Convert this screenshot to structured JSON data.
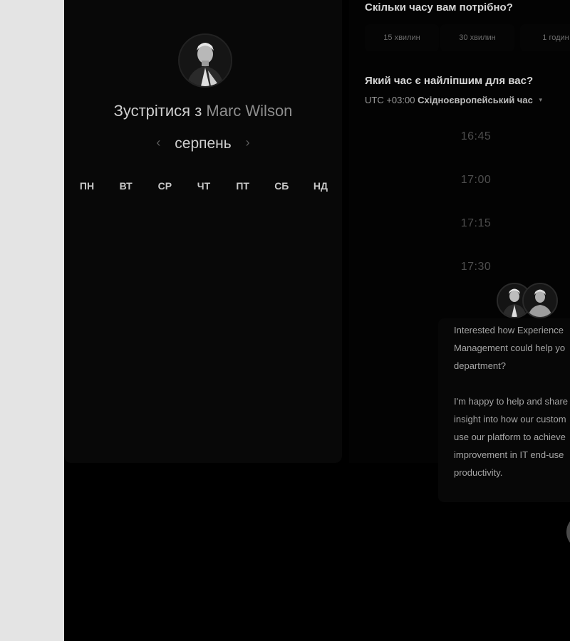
{
  "scheduler": {
    "title_prefix": "Зустрітися з",
    "host_name": "Marc Wilson",
    "month": "серпень",
    "prev_arrow": "‹",
    "next_arrow": "›",
    "weekdays": [
      "ПН",
      "ВТ",
      "СР",
      "ЧТ",
      "ПТ",
      "СБ",
      "НД"
    ]
  },
  "duration": {
    "question": "Скільки часу вам потрібно?",
    "options": [
      "15 хвилин",
      "30 хвилин",
      "1 годин"
    ]
  },
  "time": {
    "question": "Який час є найліпшим для вас?",
    "tz_offset": "UTC +03:00",
    "tz_name": "Східноєвропейський час",
    "tz_caret": "▾",
    "slots": [
      "16:45",
      "17:00",
      "17:15",
      "17:30"
    ]
  },
  "chat": {
    "paragraph1": "Interested how Experience\nManagement could help yo\ndepartment?",
    "paragraph2": "I'm happy to help and share\ninsight into how our custom\nuse our platform to achieve\nimprovement in IT end-use\nproductivity."
  },
  "icons": {
    "host_avatar": "person-avatar",
    "chat_avatars": [
      "person-avatar",
      "person-avatar"
    ],
    "launcher": "chat-launcher-icon"
  }
}
